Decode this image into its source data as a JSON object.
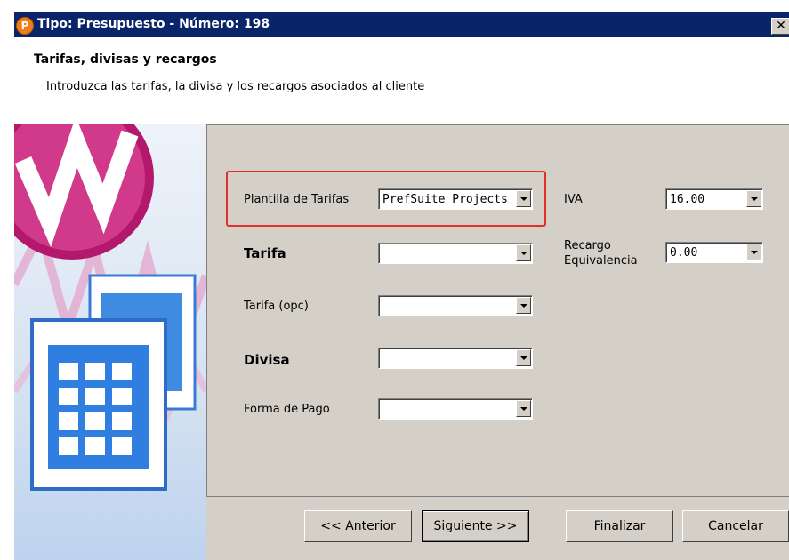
{
  "window": {
    "title": "Tipo: Presupuesto - Número: 198",
    "close_label": "✕",
    "app_icon_letter": "P"
  },
  "header": {
    "title": "Tarifas, divisas y recargos",
    "subtitle": "Introduzca las tarifas, la divisa y los recargos asociados al cliente"
  },
  "form": {
    "plantilla": {
      "label": "Plantilla de Tarifas",
      "value": "PrefSuite Projects"
    },
    "tarifa": {
      "label": "Tarifa",
      "value": ""
    },
    "tarifa_opc": {
      "label": "Tarifa (opc)",
      "value": ""
    },
    "divisa": {
      "label": "Divisa",
      "value": ""
    },
    "forma_pago": {
      "label": "Forma de Pago",
      "value": ""
    },
    "iva": {
      "label": "IVA",
      "value": "16.00"
    },
    "recargo": {
      "label_line1": "Recargo",
      "label_line2": "Equivalencia",
      "value": "0.00"
    }
  },
  "buttons": {
    "anterior": "<< Anterior",
    "siguiente": "Siguiente >>",
    "finalizar": "Finalizar",
    "cancelar": "Cancelar"
  },
  "colors": {
    "title_bar": "#0a246a",
    "dialog_bg": "#d4d0c8",
    "highlight": "#e0302a",
    "logo_magenta": "#b3186c"
  }
}
